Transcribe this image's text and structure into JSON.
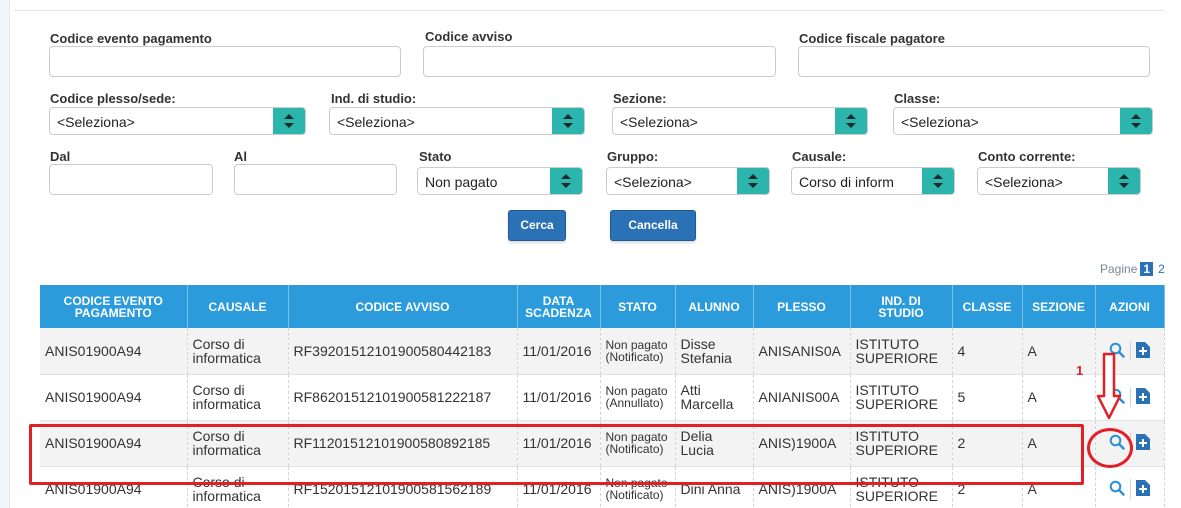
{
  "filters": {
    "codice_evento_label": "Codice evento pagamento",
    "codice_avviso_label": "Codice avviso",
    "codice_fiscale_label": "Codice fiscale pagatore",
    "plesso_label": "Codice plesso/sede:",
    "plesso_value": "<Seleziona>",
    "ind_studio_label": "Ind. di studio:",
    "ind_studio_value": "<Seleziona>",
    "sezione_label": "Sezione:",
    "sezione_value": "<Seleziona>",
    "classe_label": "Classe:",
    "classe_value": "<Seleziona>",
    "dal_label": "Dal",
    "al_label": "Al",
    "stato_label": "Stato",
    "stato_value": "Non pagato",
    "gruppo_label": "Gruppo:",
    "gruppo_value": "<Seleziona>",
    "causale_label": "Causale:",
    "causale_value": "Corso di inform",
    "conto_label": "Conto corrente:",
    "conto_value": "<Seleziona>",
    "cerca": "Cerca",
    "cancella": "Cancella"
  },
  "pager": {
    "label": "Pagine",
    "current": "1",
    "next": "2"
  },
  "table": {
    "headers": {
      "codice_evento_1": "CODICE EVENTO",
      "codice_evento_2": "PAGAMENTO",
      "causale": "CAUSALE",
      "codice_avviso": "CODICE AVVISO",
      "data_1": "DATA",
      "data_2": "SCADENZA",
      "stato": "STATO",
      "alunno": "ALUNNO",
      "plesso": "PLESSO",
      "ind_1": "IND. DI",
      "ind_2": "STUDIO",
      "classe": "CLASSE",
      "sezione": "SEZIONE",
      "azioni": "AZIONI"
    },
    "rows": [
      {
        "codice": "ANIS01900A94",
        "causale_1": "Corso di",
        "causale_2": "informatica",
        "avviso": "RF39201512101900580442183",
        "data": "11/01/2016",
        "stato_1": "Non pagato",
        "stato_2": "(Notificato)",
        "alunno_1": "Disse",
        "alunno_2": "Stefania",
        "plesso": "ANISANIS0A",
        "ind_1": "ISTITUTO",
        "ind_2": "SUPERIORE",
        "classe": "4",
        "sezione": "A"
      },
      {
        "codice": "ANIS01900A94",
        "causale_1": "Corso di",
        "causale_2": "informatica",
        "avviso": "RF86201512101900581222187",
        "data": "11/01/2016",
        "stato_1": "Non pagato",
        "stato_2": "(Annullato)",
        "alunno_1": "Atti",
        "alunno_2": "Marcella",
        "plesso": "ANIANIS00A",
        "ind_1": "ISTITUTO",
        "ind_2": "SUPERIORE",
        "classe": "5",
        "sezione": "A"
      },
      {
        "codice": "ANIS01900A94",
        "causale_1": "Corso di",
        "causale_2": "informatica",
        "avviso": "RF11201512101900580892185",
        "data": "11/01/2016",
        "stato_1": "Non pagato",
        "stato_2": "(Notificato)",
        "alunno_1": "Delia",
        "alunno_2": "Lucia",
        "plesso": "ANIS)1900A",
        "ind_1": "ISTITUTO",
        "ind_2": "SUPERIORE",
        "classe": "2",
        "sezione": "A"
      },
      {
        "codice": "ANIS01900A94",
        "causale_1": "Corso di",
        "causale_2": "informatica",
        "avviso": "RF15201512101900581562189",
        "data": "11/01/2016",
        "stato_1": "Non pagato",
        "stato_2": "(Notificato)",
        "alunno_1": "Dini Anna",
        "alunno_2": "",
        "plesso": "ANIS)1900A",
        "ind_1": "ISTITUTO",
        "ind_2": "SUPERIORE",
        "classe": "2",
        "sezione": "A"
      }
    ]
  },
  "annotation": {
    "step_number": "1",
    "color": "#e21e26"
  },
  "colors": {
    "header_blue": "#2b9bdb",
    "button_blue": "#2b71b6",
    "select_teal": "#2bb5ac"
  }
}
